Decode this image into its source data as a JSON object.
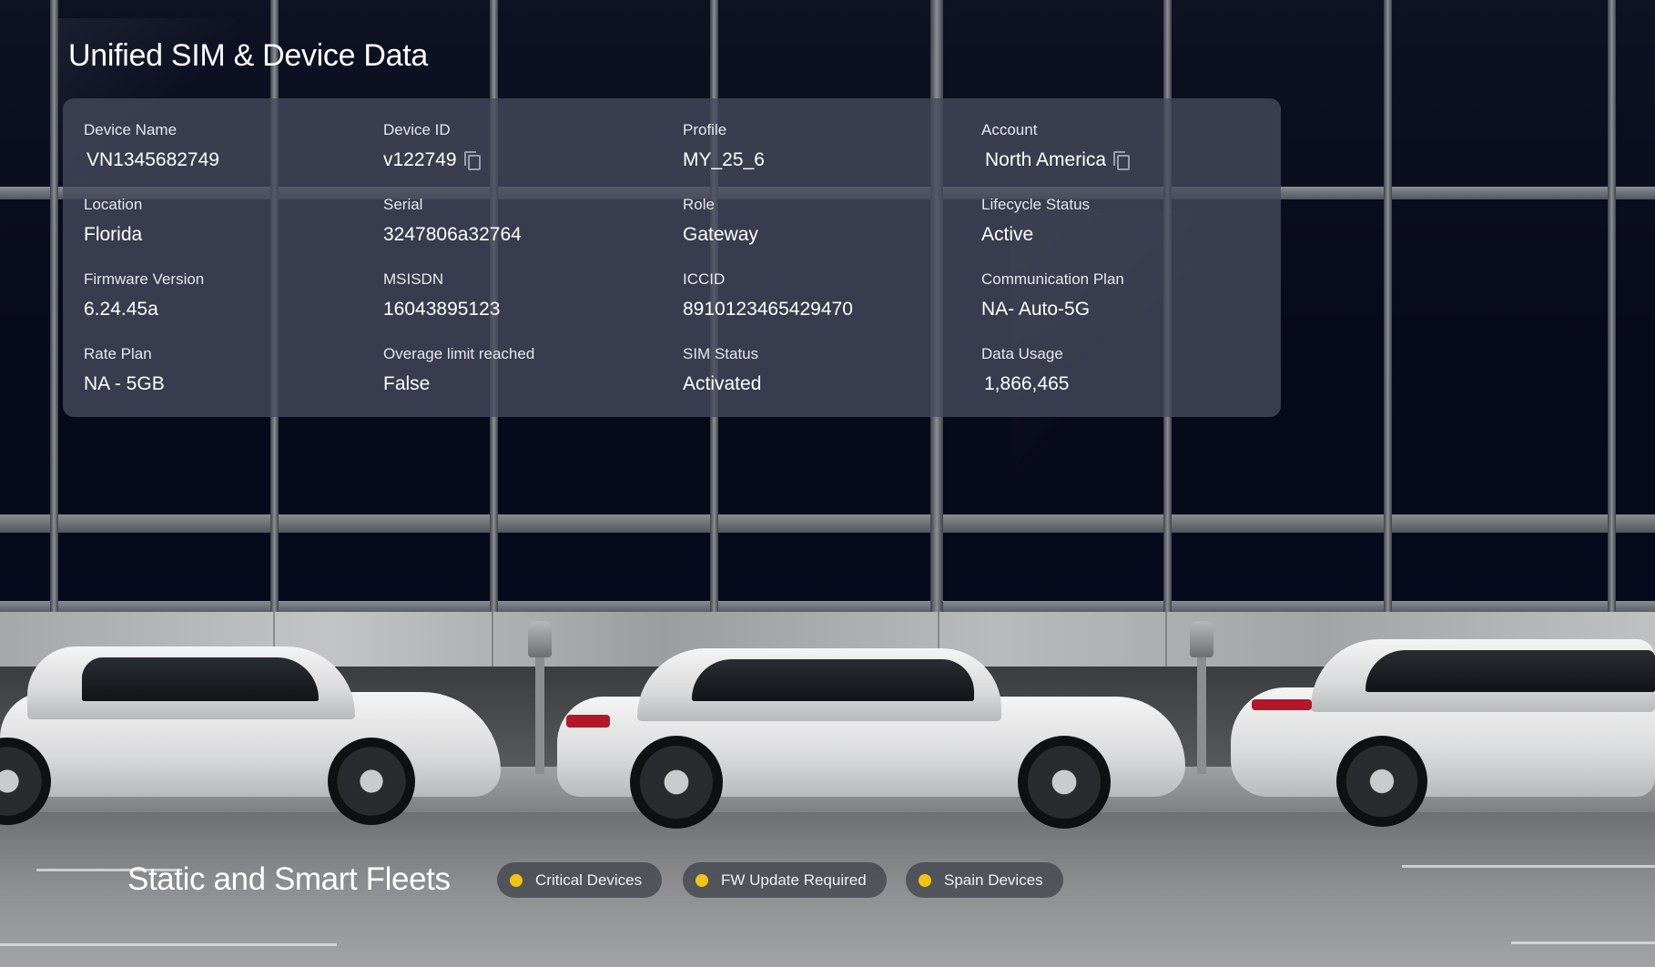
{
  "header": {
    "title": "Unified SIM  & Device Data"
  },
  "device": {
    "fields": [
      {
        "label": "Device Name",
        "value": "VN1345682749"
      },
      {
        "label": "Device ID",
        "value": "v122749"
      },
      {
        "label": "Profile",
        "value": "MY_25_6"
      },
      {
        "label": "Account",
        "value": "North America"
      },
      {
        "label": "Location",
        "value": "Florida"
      },
      {
        "label": "Serial",
        "value": "3247806a32764"
      },
      {
        "label": "Role",
        "value": "Gateway"
      },
      {
        "label": "Lifecycle Status",
        "value": "Active"
      },
      {
        "label": "Firmware Version",
        "value": "6.24.45a"
      },
      {
        "label": "MSISDN",
        "value": "16043895123"
      },
      {
        "label": "ICCID",
        "value": "8910123465429470"
      },
      {
        "label": "Communication Plan",
        "value": "NA- Auto-5G"
      },
      {
        "label": "Rate Plan",
        "value": "NA - 5GB"
      },
      {
        "label": "Overage limit reached",
        "value": "False"
      },
      {
        "label": "SIM Status",
        "value": "Activated"
      },
      {
        "label": "Data Usage",
        "value": "1,866,465"
      }
    ]
  },
  "fleets": {
    "title": "Static and Smart Fleets",
    "chips": [
      {
        "label": "Critical Devices",
        "dot_color": "#f3c313"
      },
      {
        "label": "FW Update Required",
        "dot_color": "#f3c313"
      },
      {
        "label": "Spain Devices",
        "dot_color": "#f3c313"
      }
    ]
  },
  "icons": {
    "copy": "copy-icon",
    "status_dot": "status-dot-icon"
  }
}
